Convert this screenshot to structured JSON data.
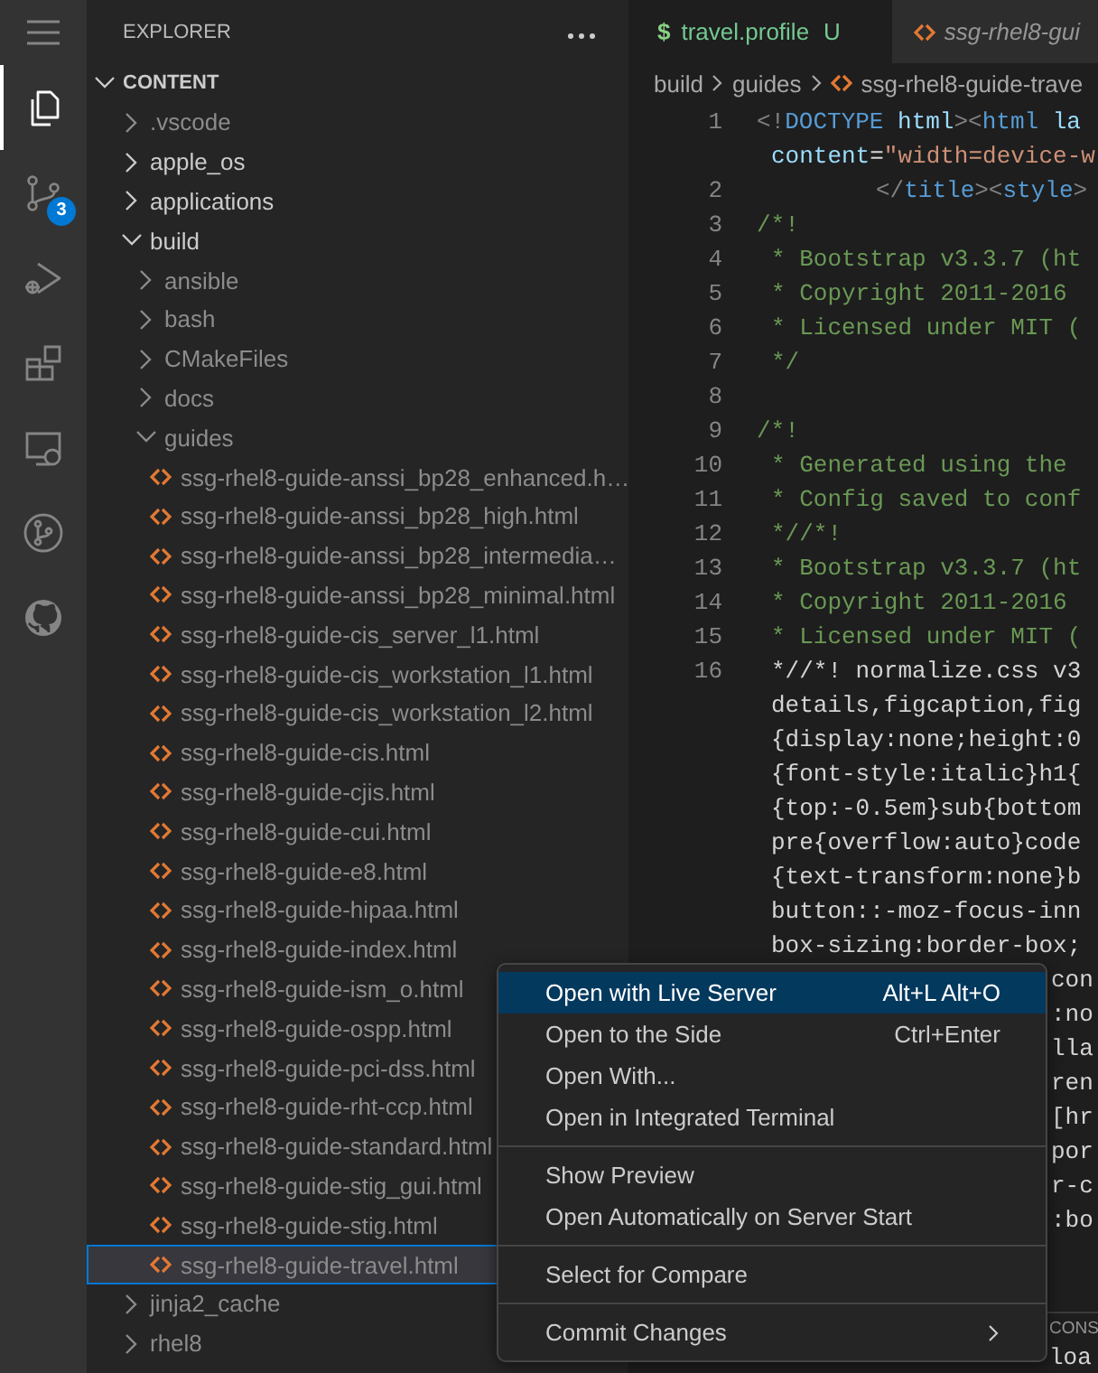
{
  "activity_bar": {
    "items": [
      {
        "kind": "menu",
        "selected": false
      },
      {
        "kind": "files",
        "selected": true
      },
      {
        "kind": "source-control",
        "selected": false,
        "badge": "3"
      },
      {
        "kind": "run-debug",
        "selected": false
      },
      {
        "kind": "extensions",
        "selected": false
      },
      {
        "kind": "remote",
        "selected": false
      },
      {
        "kind": "branch",
        "selected": false
      },
      {
        "kind": "github",
        "selected": false
      }
    ]
  },
  "sidebar": {
    "title": "EXPLORER",
    "section": {
      "title": "CONTENT",
      "expanded": true
    },
    "tree": [
      {
        "kind": "folder",
        "label": ".vscode",
        "expanded": false,
        "dimmed": true,
        "selected": false
      },
      {
        "kind": "folder",
        "label": "apple_os",
        "expanded": false,
        "dimmed": false,
        "selected": false
      },
      {
        "kind": "folder",
        "label": "applications",
        "expanded": false,
        "dimmed": false,
        "selected": false
      },
      {
        "kind": "folder",
        "label": "build",
        "expanded": true,
        "dimmed": false,
        "selected": false,
        "children": [
          {
            "kind": "folder",
            "label": "ansible",
            "expanded": false,
            "dimmed": true,
            "selected": false
          },
          {
            "kind": "folder",
            "label": "bash",
            "expanded": false,
            "dimmed": true,
            "selected": false
          },
          {
            "kind": "folder",
            "label": "CMakeFiles",
            "expanded": false,
            "dimmed": true,
            "selected": false
          },
          {
            "kind": "folder",
            "label": "docs",
            "expanded": false,
            "dimmed": true,
            "selected": false
          },
          {
            "kind": "folder",
            "label": "guides",
            "expanded": true,
            "dimmed": true,
            "selected": false,
            "children": [
              {
                "kind": "file",
                "label": "ssg-rhel8-guide-anssi_bp28_enhanced.h…",
                "dimmed": true,
                "selected": false
              },
              {
                "kind": "file",
                "label": "ssg-rhel8-guide-anssi_bp28_high.html",
                "dimmed": true,
                "selected": false
              },
              {
                "kind": "file",
                "label": "ssg-rhel8-guide-anssi_bp28_intermedia…",
                "dimmed": true,
                "selected": false
              },
              {
                "kind": "file",
                "label": "ssg-rhel8-guide-anssi_bp28_minimal.html",
                "dimmed": true,
                "selected": false
              },
              {
                "kind": "file",
                "label": "ssg-rhel8-guide-cis_server_l1.html",
                "dimmed": true,
                "selected": false
              },
              {
                "kind": "file",
                "label": "ssg-rhel8-guide-cis_workstation_l1.html",
                "dimmed": true,
                "selected": false
              },
              {
                "kind": "file",
                "label": "ssg-rhel8-guide-cis_workstation_l2.html",
                "dimmed": true,
                "selected": false
              },
              {
                "kind": "file",
                "label": "ssg-rhel8-guide-cis.html",
                "dimmed": true,
                "selected": false
              },
              {
                "kind": "file",
                "label": "ssg-rhel8-guide-cjis.html",
                "dimmed": true,
                "selected": false
              },
              {
                "kind": "file",
                "label": "ssg-rhel8-guide-cui.html",
                "dimmed": true,
                "selected": false
              },
              {
                "kind": "file",
                "label": "ssg-rhel8-guide-e8.html",
                "dimmed": true,
                "selected": false
              },
              {
                "kind": "file",
                "label": "ssg-rhel8-guide-hipaa.html",
                "dimmed": true,
                "selected": false
              },
              {
                "kind": "file",
                "label": "ssg-rhel8-guide-index.html",
                "dimmed": true,
                "selected": false
              },
              {
                "kind": "file",
                "label": "ssg-rhel8-guide-ism_o.html",
                "dimmed": true,
                "selected": false
              },
              {
                "kind": "file",
                "label": "ssg-rhel8-guide-ospp.html",
                "dimmed": true,
                "selected": false
              },
              {
                "kind": "file",
                "label": "ssg-rhel8-guide-pci-dss.html",
                "dimmed": true,
                "selected": false
              },
              {
                "kind": "file",
                "label": "ssg-rhel8-guide-rht-ccp.html",
                "dimmed": true,
                "selected": false
              },
              {
                "kind": "file",
                "label": "ssg-rhel8-guide-standard.html",
                "dimmed": true,
                "selected": false
              },
              {
                "kind": "file",
                "label": "ssg-rhel8-guide-stig_gui.html",
                "dimmed": true,
                "selected": false
              },
              {
                "kind": "file",
                "label": "ssg-rhel8-guide-stig.html",
                "dimmed": true,
                "selected": false
              },
              {
                "kind": "file",
                "label": "ssg-rhel8-guide-travel.html",
                "dimmed": true,
                "selected": true
              }
            ]
          }
        ]
      },
      {
        "kind": "folder",
        "label": "jinja2_cache",
        "expanded": false,
        "dimmed": true,
        "selected": false
      },
      {
        "kind": "folder",
        "label": "rhel8",
        "expanded": false,
        "dimmed": true,
        "selected": false
      }
    ]
  },
  "editor": {
    "tabs": [
      {
        "kind": "shell",
        "glyph": "$",
        "label": "travel.profile",
        "status": "U",
        "selected": true,
        "preview": false
      },
      {
        "kind": "html",
        "label": "ssg-rhel8-gui",
        "selected": false,
        "preview": true
      }
    ],
    "breadcrumb": [
      {
        "kind": "folder",
        "label": "build"
      },
      {
        "kind": "folder",
        "label": "guides"
      },
      {
        "kind": "html",
        "label": "ssg-rhel8-guide-trave"
      }
    ],
    "code": [
      {
        "kind": "line",
        "number": "1",
        "tokens": [
          {
            "kind": "punct",
            "text": "<!"
          },
          {
            "kind": "tag",
            "text": "DOCTYPE"
          },
          {
            "kind": "attr",
            "text": " html"
          },
          {
            "kind": "punct",
            "text": "><"
          },
          {
            "kind": "tag",
            "text": "html"
          },
          {
            "kind": "attr",
            "text": " la"
          }
        ]
      },
      {
        "kind": "wrap",
        "tokens": [
          {
            "kind": "attr",
            "text": "content"
          },
          {
            "kind": "plain",
            "text": "="
          },
          {
            "kind": "string",
            "text": "\"width=device-w"
          }
        ]
      },
      {
        "kind": "indented",
        "number": "2",
        "tokens": [
          {
            "kind": "punct",
            "text": "</"
          },
          {
            "kind": "tag",
            "text": "title"
          },
          {
            "kind": "punct",
            "text": "><"
          },
          {
            "kind": "tag",
            "text": "style"
          },
          {
            "kind": "punct",
            "text": ">"
          }
        ]
      },
      {
        "kind": "line",
        "number": "3",
        "tokens": [
          {
            "kind": "comment",
            "text": "/*!"
          }
        ]
      },
      {
        "kind": "wrap",
        "number": "4",
        "tokens": [
          {
            "kind": "comment",
            "text": "* Bootstrap v3.3.7 (ht"
          }
        ]
      },
      {
        "kind": "wrap",
        "number": "5",
        "tokens": [
          {
            "kind": "comment",
            "text": "* Copyright 2011-2016"
          }
        ]
      },
      {
        "kind": "wrap",
        "number": "6",
        "tokens": [
          {
            "kind": "comment",
            "text": "* Licensed under MIT ("
          }
        ]
      },
      {
        "kind": "wrap",
        "number": "7",
        "tokens": [
          {
            "kind": "comment",
            "text": "*/"
          }
        ]
      },
      {
        "kind": "line",
        "number": "8"
      },
      {
        "kind": "line",
        "number": "9",
        "tokens": [
          {
            "kind": "comment",
            "text": "/*!"
          }
        ]
      },
      {
        "kind": "wrap",
        "number": "10",
        "tokens": [
          {
            "kind": "comment",
            "text": "* Generated using the"
          }
        ]
      },
      {
        "kind": "wrap",
        "number": "11",
        "tokens": [
          {
            "kind": "comment",
            "text": "* Config saved to conf"
          }
        ]
      },
      {
        "kind": "wrap",
        "number": "12",
        "tokens": [
          {
            "kind": "comment",
            "text": "*//*!"
          }
        ]
      },
      {
        "kind": "wrap",
        "number": "13",
        "tokens": [
          {
            "kind": "comment",
            "text": "* Bootstrap v3.3.7 (ht"
          }
        ]
      },
      {
        "kind": "wrap",
        "number": "14",
        "tokens": [
          {
            "kind": "comment",
            "text": "* Copyright 2011-2016"
          }
        ]
      },
      {
        "kind": "wrap",
        "number": "15",
        "tokens": [
          {
            "kind": "comment",
            "text": "* Licensed under MIT ("
          }
        ]
      },
      {
        "kind": "wrap",
        "number": "16",
        "tokens": [
          {
            "kind": "plain",
            "text": "*//*! normalize.css v3"
          }
        ]
      },
      {
        "kind": "wrap",
        "tokens": [
          {
            "kind": "plain",
            "text": "details,figcaption,fig"
          }
        ]
      },
      {
        "kind": "wrap",
        "tokens": [
          {
            "kind": "plain",
            "text": "{display:none;height:0"
          }
        ]
      },
      {
        "kind": "wrap",
        "tokens": [
          {
            "kind": "plain",
            "text": "{font-style:italic}h1{"
          }
        ]
      },
      {
        "kind": "wrap",
        "tokens": [
          {
            "kind": "plain",
            "text": "{top:-0.5em}sub{bottom"
          }
        ]
      },
      {
        "kind": "wrap",
        "tokens": [
          {
            "kind": "plain",
            "text": "pre{overflow:auto}code"
          }
        ]
      },
      {
        "kind": "wrap",
        "tokens": [
          {
            "kind": "plain",
            "text": "{text-transform:none}b"
          }
        ]
      },
      {
        "kind": "wrap",
        "tokens": [
          {
            "kind": "plain",
            "text": "button::-moz-focus-inn"
          }
        ]
      },
      {
        "kind": "wrap",
        "tokens": [
          {
            "kind": "plain",
            "text": "box-sizing:border-box;"
          }
        ]
      },
      {
        "kind": "covered",
        "tokens": [
          {
            "kind": "plain",
            "text": "con"
          }
        ]
      },
      {
        "kind": "covered",
        "tokens": [
          {
            "kind": "plain",
            "text": ":no"
          }
        ]
      },
      {
        "kind": "covered",
        "tokens": [
          {
            "kind": "plain",
            "text": "lla"
          }
        ]
      },
      {
        "kind": "covered",
        "tokens": [
          {
            "kind": "plain",
            "text": "ren"
          }
        ]
      },
      {
        "kind": "covered",
        "tokens": [
          {
            "kind": "plain",
            "text": "[hr"
          }
        ]
      },
      {
        "kind": "covered",
        "tokens": [
          {
            "kind": "plain",
            "text": "por"
          }
        ]
      },
      {
        "kind": "covered",
        "tokens": [
          {
            "kind": "plain",
            "text": "r-c"
          }
        ]
      },
      {
        "kind": "covered",
        "tokens": [
          {
            "kind": "plain",
            "text": ":bo"
          }
        ]
      }
    ],
    "panel": {
      "tab": "CONS",
      "lines": [
        "loa"
      ]
    }
  },
  "context_menu": {
    "groups": [
      [
        {
          "label": "Open with Live Server",
          "shortcut": "Alt+L Alt+O",
          "selected": true,
          "submenu": false
        },
        {
          "label": "Open to the Side",
          "shortcut": "Ctrl+Enter",
          "selected": false,
          "submenu": false
        },
        {
          "label": "Open With...",
          "selected": false,
          "submenu": false
        },
        {
          "label": "Open in Integrated Terminal",
          "selected": false,
          "submenu": false
        }
      ],
      [
        {
          "label": "Show Preview",
          "selected": false,
          "submenu": false
        },
        {
          "label": "Open Automatically on Server Start",
          "selected": false,
          "submenu": false
        }
      ],
      [
        {
          "label": "Select for Compare",
          "selected": false,
          "submenu": false
        }
      ],
      [
        {
          "label": "Commit Changes",
          "selected": false,
          "submenu": true
        }
      ]
    ]
  }
}
